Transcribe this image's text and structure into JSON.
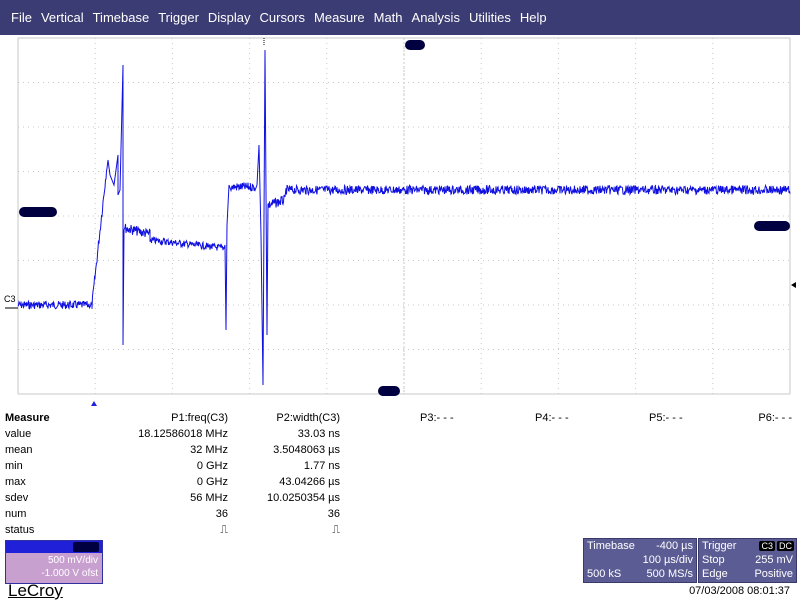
{
  "menu": [
    "File",
    "Vertical",
    "Timebase",
    "Trigger",
    "Display",
    "Cursors",
    "Measure",
    "Math",
    "Analysis",
    "Utilities",
    "Help"
  ],
  "trace": {
    "label": "C3",
    "color": "#1010e0"
  },
  "measure": {
    "title": "Measure",
    "params": {
      "p1": "P1:freq(C3)",
      "p2": "P2:width(C3)",
      "p3": "P3:- - -",
      "p4": "P4:- - -",
      "p5": "P5:- - -",
      "p6": "P6:- - -"
    },
    "rows": [
      {
        "label": "value",
        "p1": "18.12586018 MHz",
        "p2": "33.03 ns"
      },
      {
        "label": "mean",
        "p1": "32 MHz",
        "p2": "3.5048063 µs"
      },
      {
        "label": "min",
        "p1": "0 GHz",
        "p2": "1.77 ns"
      },
      {
        "label": "max",
        "p1": "0 GHz",
        "p2": "43.04266 µs"
      },
      {
        "label": "sdev",
        "p1": "56 MHz",
        "p2": "10.0250354 µs"
      },
      {
        "label": "num",
        "p1": "36",
        "p2": "36"
      },
      {
        "label": "status",
        "p1": "⎍",
        "p2": "⎍"
      }
    ]
  },
  "channel": {
    "vdiv": "500 mV/div",
    "offset": "-1.000 V ofst"
  },
  "timebase": {
    "title": "Timebase",
    "delay": "-400 µs",
    "tdiv": "100 µs/div",
    "samples": "500 kS",
    "rate": "500 MS/s"
  },
  "trigger": {
    "title": "Trigger",
    "source": "C3",
    "coupling": "DC",
    "mode": "Stop",
    "level": "255 mV",
    "type": "Edge",
    "slope": "Positive"
  },
  "brand": "LeCroy",
  "datetime": "07/03/2008 08:01:37"
}
